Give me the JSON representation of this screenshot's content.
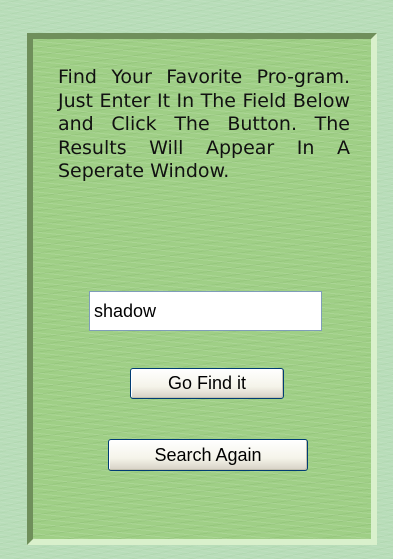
{
  "instructions": {
    "text": "Find Your Favorite Pro-­gram. Just Enter It In The Field Below and Click The Button. The Results Will Appear In A Seperate Window."
  },
  "search": {
    "value": "shadow"
  },
  "buttons": {
    "find_label": "Go Find it",
    "again_label": "Search Again"
  },
  "colors": {
    "background": "#b8ddb9",
    "panel": "#9fcf86",
    "panel_shadow": "#6f8f5b",
    "panel_highlight": "#d9f0cc",
    "button_border": "#003c74"
  }
}
